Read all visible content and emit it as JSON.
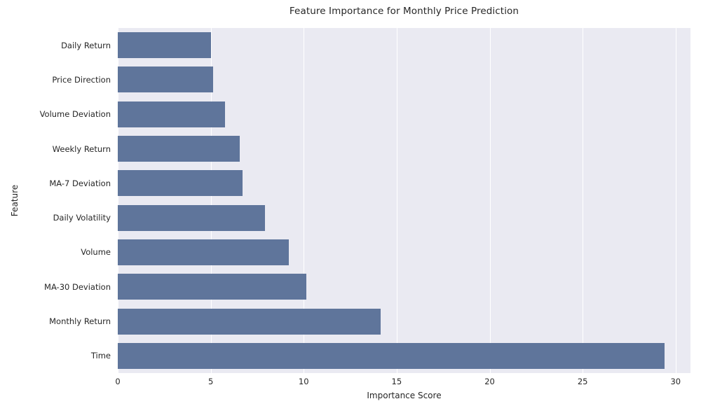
{
  "chart_data": {
    "type": "bar",
    "orientation": "horizontal",
    "title": "Feature Importance for Monthly Price Prediction",
    "xlabel": "Importance Score",
    "ylabel": "Feature",
    "categories": [
      "Daily Return",
      "Price Direction",
      "Volume Deviation",
      "Weekly Return",
      "MA-7 Deviation",
      "Daily Volatility",
      "Volume",
      "MA-30 Deviation",
      "Monthly Return",
      "Time"
    ],
    "values": [
      5.03,
      5.12,
      5.77,
      6.56,
      6.7,
      7.92,
      9.21,
      10.15,
      14.15,
      29.4
    ],
    "xlim": [
      0,
      30.8
    ],
    "xticks": [
      0,
      5,
      10,
      15,
      20,
      25,
      30
    ],
    "xtick_labels": [
      "0",
      "5",
      "10",
      "15",
      "20",
      "25",
      "30"
    ],
    "grid": true,
    "grid_axis": "x",
    "legend": null,
    "style": "seaborn-darkgrid",
    "bar_color": "#5f759b",
    "axes_background": "#eaeaf2",
    "figure_background": "#ffffff",
    "text_color": "#262626"
  }
}
